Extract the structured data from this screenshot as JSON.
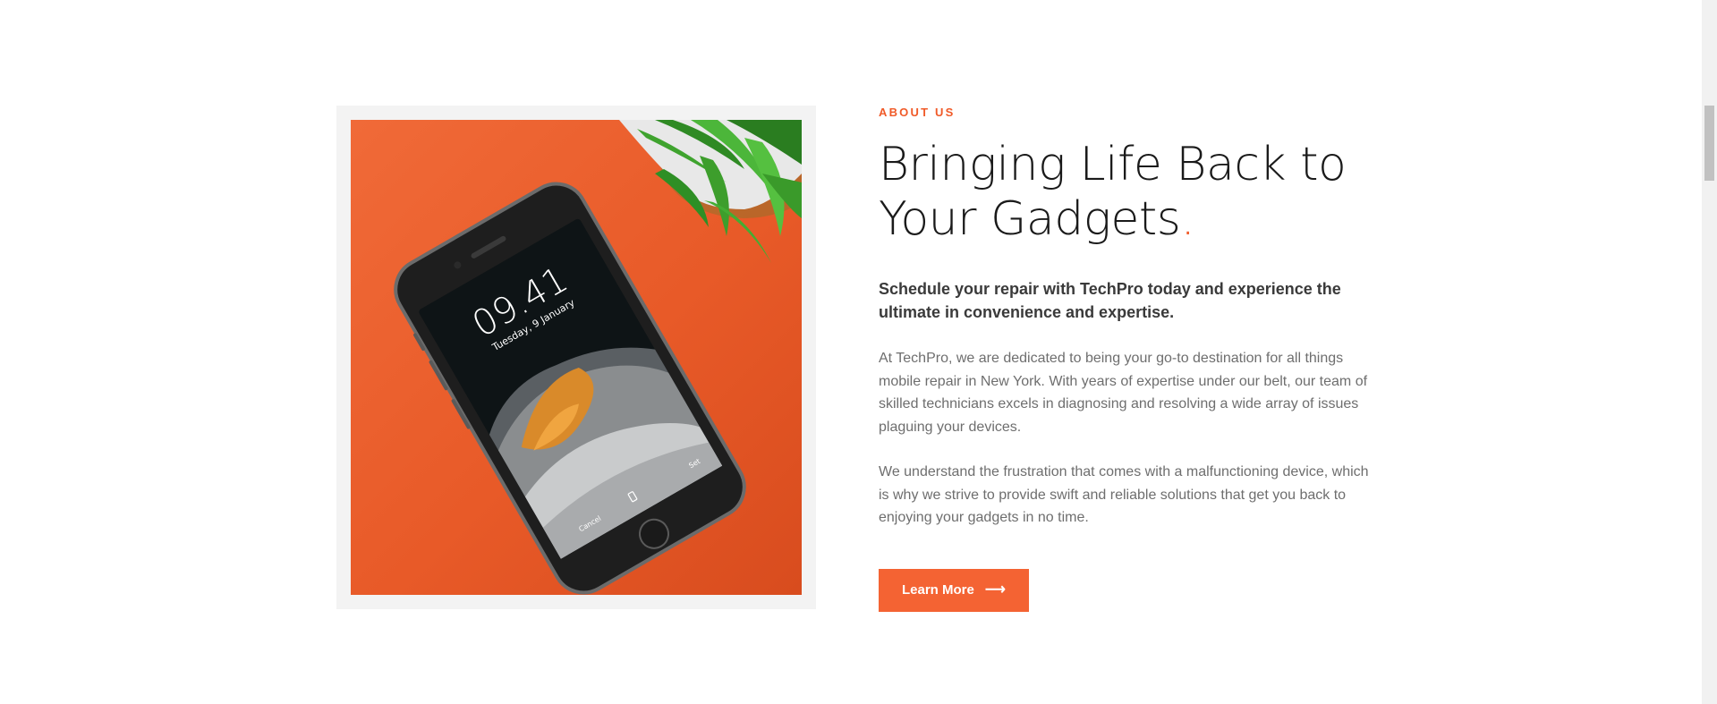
{
  "about": {
    "eyebrow": "ABOUT US",
    "heading_line1": "Bringing Life Back to",
    "heading_line2": "Your Gadgets",
    "heading_dot": ".",
    "lead": "Schedule your repair with TechPro today and experience the ultimate in convenience and expertise.",
    "paragraphs": [
      "At TechPro, we are dedicated to being your go-to destination for all things mobile repair in New York. With years of expertise under our belt, our team of skilled technicians excels in diagnosing and resolving a wide array of issues plaguing your devices.",
      "We understand the frustration that comes with a malfunctioning device, which is why we strive to provide swift and reliable solutions that get you back to enjoying your gadgets in no time."
    ],
    "button_label": "Learn More",
    "button_icon": "arrow-right-icon"
  },
  "image": {
    "phone_time": "09.41",
    "phone_date": "Tuesday, 9 January",
    "phone_cancel": "Cancel",
    "phone_set": "Set"
  },
  "colors": {
    "accent": "#f05a28",
    "button": "#f46333",
    "image_bg": "#e85a28"
  }
}
